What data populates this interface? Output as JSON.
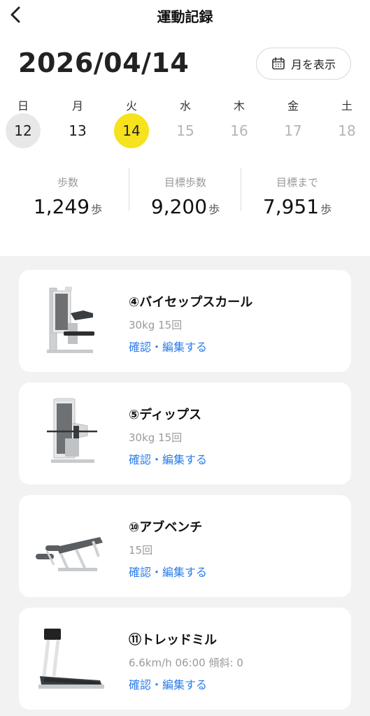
{
  "header": {
    "title": "運動記録"
  },
  "date": {
    "display": "2026/04/14"
  },
  "month_button": {
    "label": "月を表示"
  },
  "week": [
    {
      "dow": "日",
      "day": "12",
      "state": "past-sel"
    },
    {
      "dow": "月",
      "day": "13",
      "state": "past"
    },
    {
      "dow": "火",
      "day": "14",
      "state": "today"
    },
    {
      "dow": "水",
      "day": "15",
      "state": "future"
    },
    {
      "dow": "木",
      "day": "16",
      "state": "future"
    },
    {
      "dow": "金",
      "day": "17",
      "state": "future"
    },
    {
      "dow": "土",
      "day": "18",
      "state": "future"
    }
  ],
  "stats": [
    {
      "label": "歩数",
      "value": "1,249",
      "unit": "歩"
    },
    {
      "label": "目標歩数",
      "value": "9,200",
      "unit": "歩"
    },
    {
      "label": "目標まで",
      "value": "7,951",
      "unit": "歩"
    }
  ],
  "workouts": [
    {
      "name": "④バイセップスカール",
      "detail": "30kg 15回",
      "link": "確認・編集する",
      "image": "bicep-curl-machine"
    },
    {
      "name": "⑤ディップス",
      "detail": "30kg 15回",
      "link": "確認・編集する",
      "image": "dips-machine"
    },
    {
      "name": "⑩アブベンチ",
      "detail": "15回",
      "link": "確認・編集する",
      "image": "ab-bench"
    },
    {
      "name": "⑪トレッドミル",
      "detail": "6.6km/h 06:00 傾斜: 0",
      "link": "確認・編集する",
      "image": "treadmill"
    }
  ],
  "colors": {
    "accent": "#f6e21d",
    "link": "#2b7de9",
    "list_bg": "#f2f2f2"
  }
}
